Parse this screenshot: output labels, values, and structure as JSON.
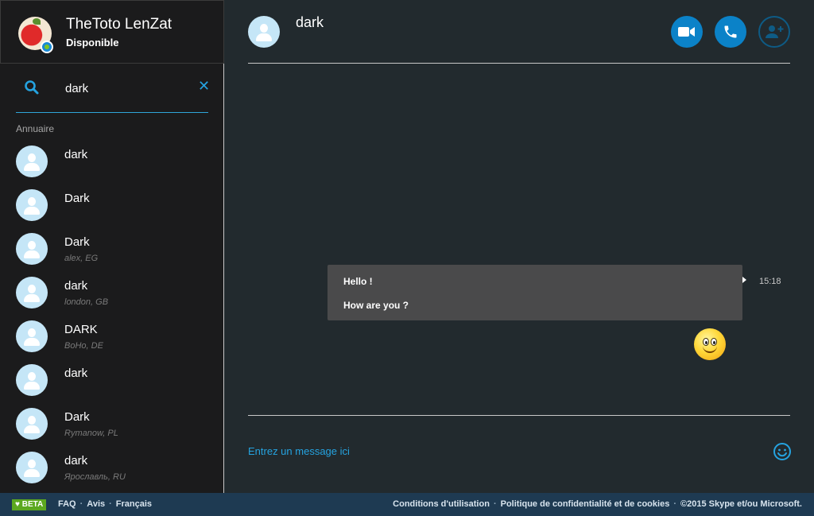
{
  "profile": {
    "name": "TheToto LenZat",
    "status": "Disponible",
    "presence_color": "#7ec424"
  },
  "search": {
    "value": "dark",
    "placeholder": ""
  },
  "directory": {
    "label": "Annuaire",
    "contacts": [
      {
        "name": "dark",
        "location": ""
      },
      {
        "name": "Dark",
        "location": ""
      },
      {
        "name": "Dark",
        "location": "alex, EG"
      },
      {
        "name": "dark",
        "location": "london, GB"
      },
      {
        "name": "DARK",
        "location": "BoHo, DE"
      },
      {
        "name": "dark",
        "location": ""
      },
      {
        "name": "Dark",
        "location": "Rymanow, PL"
      },
      {
        "name": "dark",
        "location": "Ярославль, RU"
      }
    ]
  },
  "chat": {
    "title": "dark",
    "messages": [
      {
        "lines": [
          "Hello !",
          "How are you ?"
        ],
        "time": "15:18"
      }
    ],
    "compose_placeholder": "Entrez un message ici"
  },
  "icons": {
    "search": "search-icon",
    "clear": "close-icon",
    "video": "video-camera-icon",
    "call": "phone-icon",
    "add": "add-contact-icon",
    "emoji": "smiley-icon"
  },
  "colors": {
    "accent": "#0b82c8",
    "link": "#25a3e0",
    "footer": "#1e3a52",
    "beta": "#5ca81f"
  },
  "footer": {
    "beta": "BETA",
    "left_links": [
      "FAQ",
      "Avis",
      "Français"
    ],
    "right_links": [
      "Conditions d'utilisation",
      "Politique de confidentialité et de cookies",
      "©2015 Skype et/ou Microsoft."
    ]
  }
}
